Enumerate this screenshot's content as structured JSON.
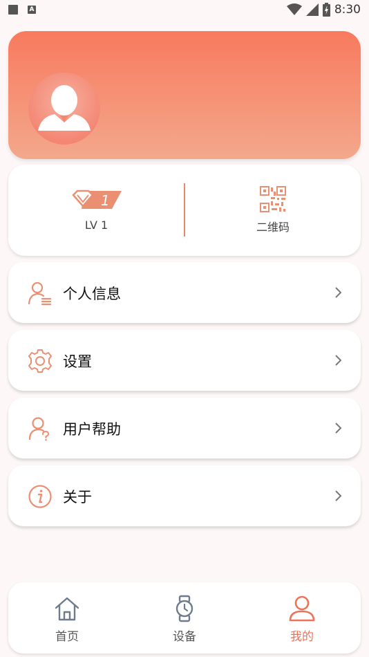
{
  "status_bar": {
    "time": "8:30",
    "left_icons": [
      "square-icon",
      "a-icon"
    ],
    "right_icons": [
      "wifi-icon",
      "signal-icon",
      "battery-icon"
    ]
  },
  "profile": {
    "avatar_icon": "user-avatar-icon",
    "gradient": [
      "#f87a5e",
      "#f3a88c"
    ]
  },
  "level_card": {
    "badge_number": "1",
    "level_label": "LV 1",
    "qr_label": "二维码",
    "accent": "#ef8466"
  },
  "menu": [
    {
      "label": "个人信息",
      "icon": "personal-info-icon"
    },
    {
      "label": "设置",
      "icon": "settings-gear-icon"
    },
    {
      "label": "用户帮助",
      "icon": "user-help-icon"
    },
    {
      "label": "关于",
      "icon": "info-icon"
    }
  ],
  "bottom_nav": {
    "items": [
      {
        "label": "首页",
        "icon": "home-icon",
        "active": false
      },
      {
        "label": "设备",
        "icon": "watch-icon",
        "active": false
      },
      {
        "label": "我的",
        "icon": "profile-icon",
        "active": true
      }
    ],
    "active_color": "#ef7257"
  }
}
